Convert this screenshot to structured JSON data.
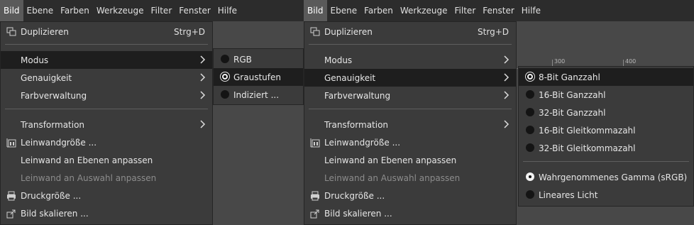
{
  "menubar": [
    "Bild",
    "Ebene",
    "Farben",
    "Werkzeuge",
    "Filter",
    "Fenster",
    "Hilfe"
  ],
  "image_menu": {
    "duplicate": {
      "label": "Duplizieren",
      "shortcut": "Strg+D"
    },
    "mode": "Modus",
    "precision": "Genauigkeit",
    "color_management": "Farbverwaltung",
    "transform": "Transformation",
    "canvas_size": "Leinwandgröße ...",
    "fit_canvas_layers": "Leinwand an Ebenen anpassen",
    "fit_canvas_selection": "Leinwand an Auswahl anpassen",
    "print_size": "Druckgröße ...",
    "scale_image": "Bild skalieren ..."
  },
  "mode_submenu": [
    "RGB",
    "Graustufen",
    "Indiziert ..."
  ],
  "mode_selected": "Graustufen",
  "precision_submenu": {
    "precision_items": [
      "8-Bit Ganzzahl",
      "16-Bit Ganzzahl",
      "32-Bit Ganzzahl",
      "16-Bit Gleitkommazahl",
      "32-Bit Gleitkommazahl"
    ],
    "gamma_items": [
      "Wahrgenommenes Gamma (sRGB)",
      "Lineares Licht"
    ],
    "selected_precision": "8-Bit Ganzzahl",
    "selected_gamma": "Wahrgenommenes Gamma (sRGB)"
  },
  "ruler_labels": [
    "300",
    "400"
  ]
}
